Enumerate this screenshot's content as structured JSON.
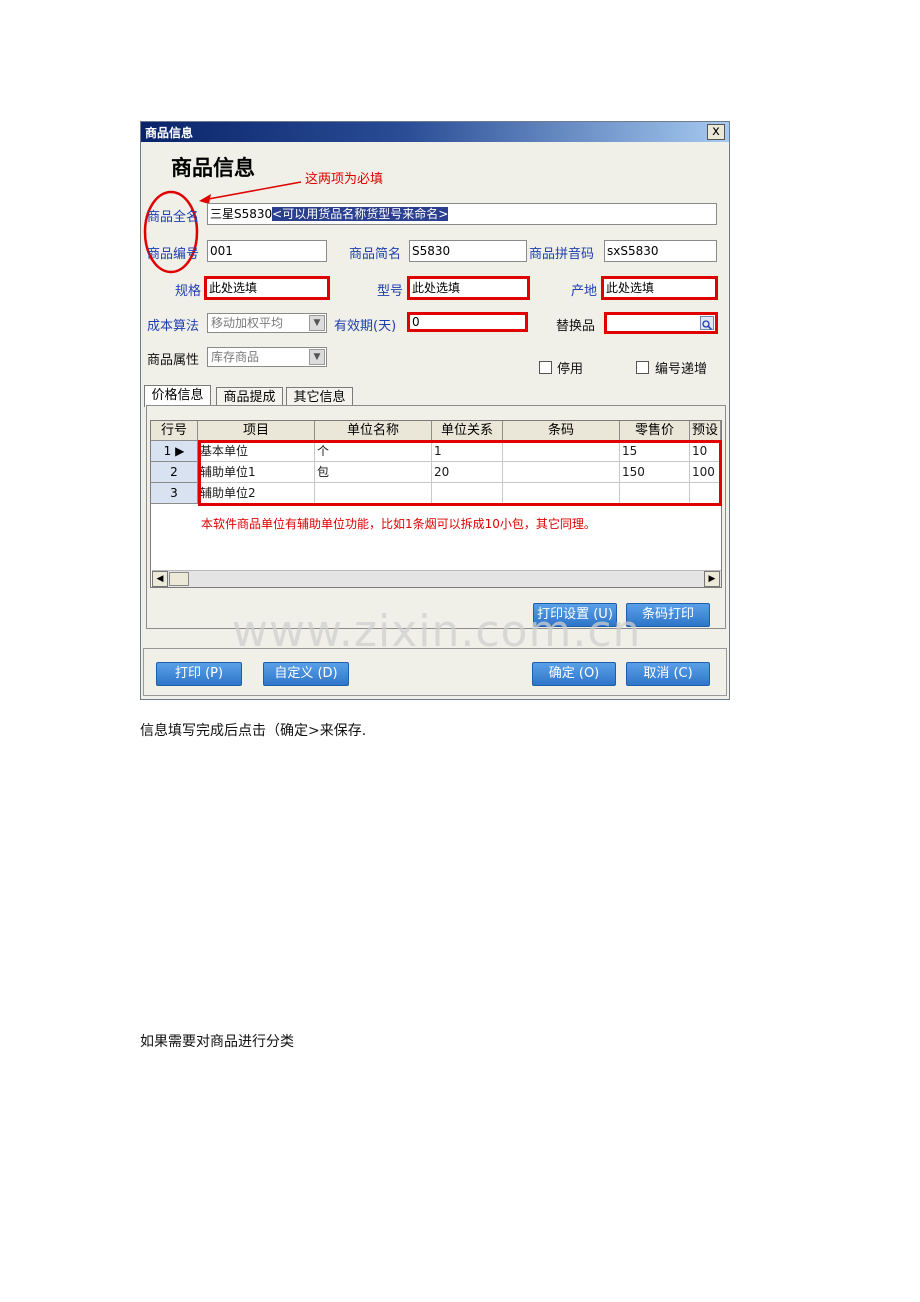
{
  "dialog": {
    "window_title": "商品信息",
    "close_glyph": "x",
    "heading": "商品信息",
    "annotation_required": "这两项为必填",
    "fields": {
      "full_name_label": "商品全名",
      "full_name_value": "三星S5830",
      "full_name_hint": "<可以用货品名称货型号来命名>",
      "code_label": "商品编号",
      "code_value": "001",
      "short_name_label": "商品简名",
      "short_name_value": "S5830",
      "pinyin_label": "商品拼音码",
      "pinyin_value": "sxS5830",
      "spec_label": "规格",
      "spec_value": "此处选填",
      "model_label": "型号",
      "model_value": "此处选填",
      "origin_label": "产地",
      "origin_value": "此处选填",
      "cost_method_label": "成本算法",
      "cost_method_value": "移动加权平均",
      "validity_label": "有效期(天)",
      "validity_value": "0",
      "substitute_label": "替换品",
      "substitute_value": "",
      "attribute_label": "商品属性",
      "attribute_value": "库存商品",
      "disable_label": "停用",
      "auto_increment_label": "编号递增"
    },
    "tabs": [
      "价格信息",
      "商品提成",
      "其它信息"
    ],
    "grid": {
      "columns": [
        "行号",
        "项目",
        "单位名称",
        "单位关系",
        "条码",
        "零售价",
        "预设"
      ],
      "rows": [
        {
          "no": "1",
          "item": "基本单位",
          "unit": "个",
          "relation": "1",
          "barcode": "",
          "retail": "15",
          "preset": "10"
        },
        {
          "no": "2",
          "item": "辅助单位1",
          "unit": "包",
          "relation": "20",
          "barcode": "",
          "retail": "150",
          "preset": "100"
        },
        {
          "no": "3",
          "item": "辅助单位2",
          "unit": "",
          "relation": "",
          "barcode": "",
          "retail": "",
          "preset": ""
        }
      ],
      "note": "本软件商品单位有辅助单位功能，比如1条烟可以拆成10小包，其它同理。"
    },
    "buttons": {
      "print_setup": "打印设置 (U)",
      "barcode_print": "条码打印",
      "print": "打印 (P)",
      "customize": "自定义 (D)",
      "ok": "确定 (O)",
      "cancel": "取消 (C)"
    }
  },
  "watermark": "www.zixin.com.cn",
  "paragraphs": {
    "p1": "信息填写完成后点击（确定>来保存.",
    "p2": "如果需要对商品进行分类"
  },
  "colors": {
    "annotation_red": "#e00000",
    "label_blue": "#1f3fb0",
    "button_blue": "#2e75c9"
  }
}
